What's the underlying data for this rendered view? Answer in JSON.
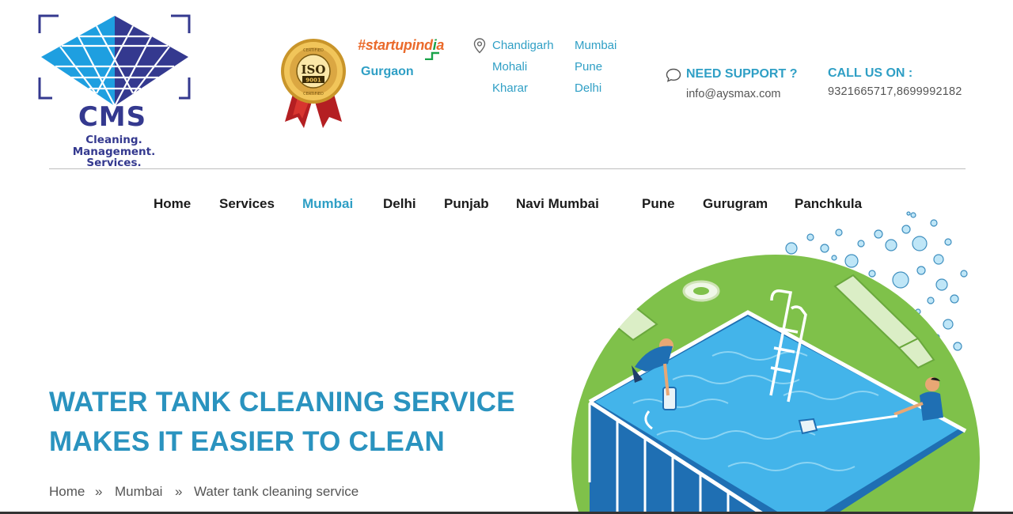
{
  "header": {
    "logo": {
      "name": "CMS",
      "tagline": [
        "Cleaning.",
        "Management.",
        "Services."
      ]
    },
    "badge": {
      "iso": "ISO",
      "number": "9001",
      "ring_text": "CERTIFIED"
    },
    "startup": {
      "hash": "#",
      "word_start": "startupind",
      "i_letter": "i",
      "word_end": "a"
    },
    "gurgaon": "Gurgaon",
    "locations": {
      "col1": [
        "Chandigarh",
        "Mohali",
        "Kharar"
      ],
      "col2": [
        "Mumbai",
        "Pune",
        "Delhi"
      ]
    },
    "support": {
      "label": "NEED SUPPORT ?",
      "email": "info@aysmax.com"
    },
    "call": {
      "label": "CALL US ON :",
      "numbers": "9321665717,8699992182"
    }
  },
  "nav": {
    "items": [
      {
        "label": "Home"
      },
      {
        "label": "Services"
      },
      {
        "label": "Mumbai",
        "active": true
      },
      {
        "label": "Delhi"
      },
      {
        "label": "Punjab"
      },
      {
        "label": "Navi Mumbai"
      },
      {
        "label": "Pune"
      },
      {
        "label": "Gurugram"
      },
      {
        "label": "Panchkula"
      }
    ]
  },
  "hero": {
    "title_line1": "WATER TANK CLEANING SERVICE",
    "title_line2": "MAKES IT EASIER TO CLEAN"
  },
  "breadcrumb": {
    "items": [
      "Home",
      "Mumbai",
      "Water tank cleaning service"
    ],
    "separator": "»"
  },
  "colors": {
    "accent": "#2f9fc5",
    "brand_navy": "#34398f",
    "logo_blue": "#1e9fe0",
    "grass": "#7fc14a",
    "water": "#3fb2e8"
  }
}
